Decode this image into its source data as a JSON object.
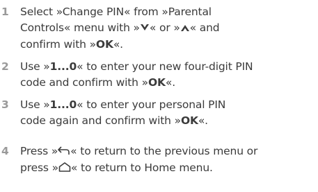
{
  "steps": [
    {
      "number": "1",
      "line1_a": "Select »Change PIN« from »Parental",
      "line2": "Controls« menu with »",
      "or_text": "« or »",
      "and_text": "« and",
      "line3_a": "confirm with »",
      "ok": "OK",
      "line3_b": "«."
    },
    {
      "number": "2",
      "line1_a": "Use »",
      "keys": "1...0",
      "line1_b": "« to enter your new four-digit PIN",
      "line2_a": "code and confirm with »",
      "ok": "OK",
      "line2_b": "«."
    },
    {
      "number": "3",
      "line1_a": "Use »",
      "keys": "1...0",
      "line1_b": "« to enter your personal PIN",
      "line2_a": "code again and confirm with »",
      "ok": "OK",
      "line2_b": "«."
    },
    {
      "number": "4",
      "line1_a": "Press »",
      "line1_b": "« to return to the previous menu or",
      "line2_a": "press »",
      "line2_b": "« to return to Home menu."
    }
  ],
  "icons": {
    "down": "chevron-down-icon",
    "up": "chevron-up-icon",
    "back": "back-arrow-icon",
    "home": "home-icon"
  },
  "colors": {
    "text": "#3b3b3b",
    "number": "#9a9a9a"
  }
}
